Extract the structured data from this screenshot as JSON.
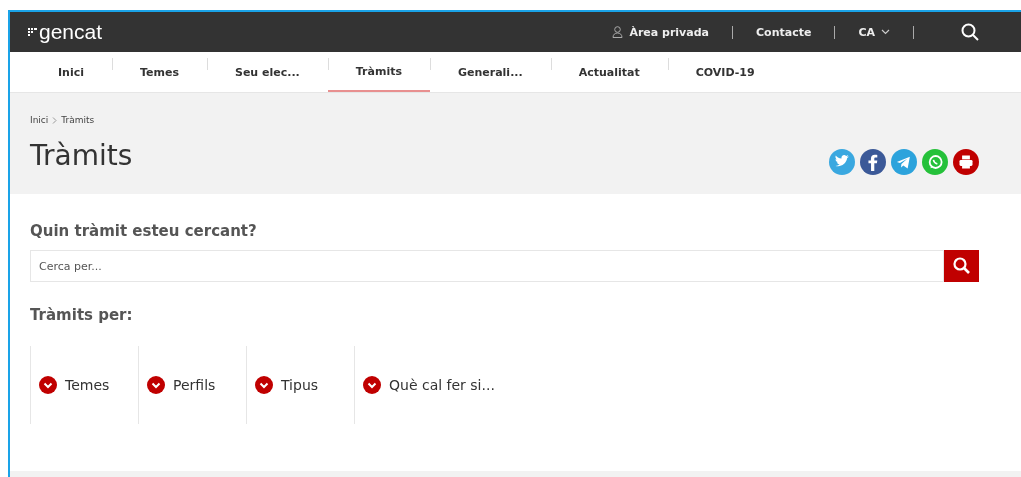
{
  "header": {
    "logo": "gencat",
    "links": [
      {
        "label": "Àrea privada",
        "kind": "user"
      },
      {
        "label": "Contacte",
        "kind": "plain"
      },
      {
        "label": "CA",
        "kind": "language"
      }
    ]
  },
  "nav": [
    {
      "label": "Inici",
      "selected": false
    },
    {
      "label": "Temes",
      "selected": false
    },
    {
      "label": "Seu elec...",
      "selected": false
    },
    {
      "label": "Tràmits",
      "selected": true
    },
    {
      "label": "Generali...",
      "selected": false
    },
    {
      "label": "Actualitat",
      "selected": false
    },
    {
      "label": "COVID-19",
      "selected": false
    }
  ],
  "breadcrumb": [
    "Inici",
    "Tràmits"
  ],
  "page_title": "Tràmits",
  "share": [
    {
      "kind": "twitter",
      "color": "#3aa8e0"
    },
    {
      "kind": "facebook",
      "color": "#3b5998"
    },
    {
      "kind": "telegram",
      "color": "#2ca3dc"
    },
    {
      "kind": "whatsapp",
      "color": "#25c13a"
    },
    {
      "kind": "print",
      "color": "#c00000"
    }
  ],
  "search": {
    "label": "Quin tràmit esteu cercant?",
    "placeholder": "Cerca per..."
  },
  "filters": {
    "label": "Tràmits per:",
    "items": [
      "Temes",
      "Perfils",
      "Tipus",
      "Què cal fer si..."
    ]
  }
}
